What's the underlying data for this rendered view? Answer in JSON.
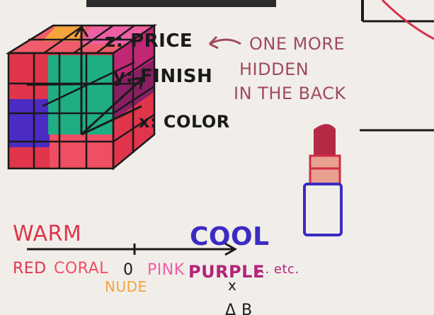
{
  "cube_axes": {
    "z_label": "z: PRICE",
    "y_label": "y: FINISH",
    "x_label": "x: COLOR"
  },
  "annotation": {
    "line1": "ONE MORE",
    "line2": "HIDDEN",
    "line3": "IN THE BACK"
  },
  "scale": {
    "warm": "WARM",
    "cool": "COOL",
    "items": [
      "RED",
      "CORAL",
      "NUDE",
      "PINK",
      "PURPLE",
      "... etc."
    ],
    "tick_labels": [
      "0",
      "x"
    ]
  },
  "bottom_marks": "Δ B",
  "colors": {
    "ink": "#1a1a1a",
    "red": "#e0354b",
    "coral": "#ef4f63",
    "green": "#1fae84",
    "orange": "#f5a33b",
    "pink": "#ee5fa6",
    "magenta": "#b4237a",
    "purple": "#4b2bc3",
    "blue": "#3a2fc9",
    "annotation": "#a04a5f"
  }
}
